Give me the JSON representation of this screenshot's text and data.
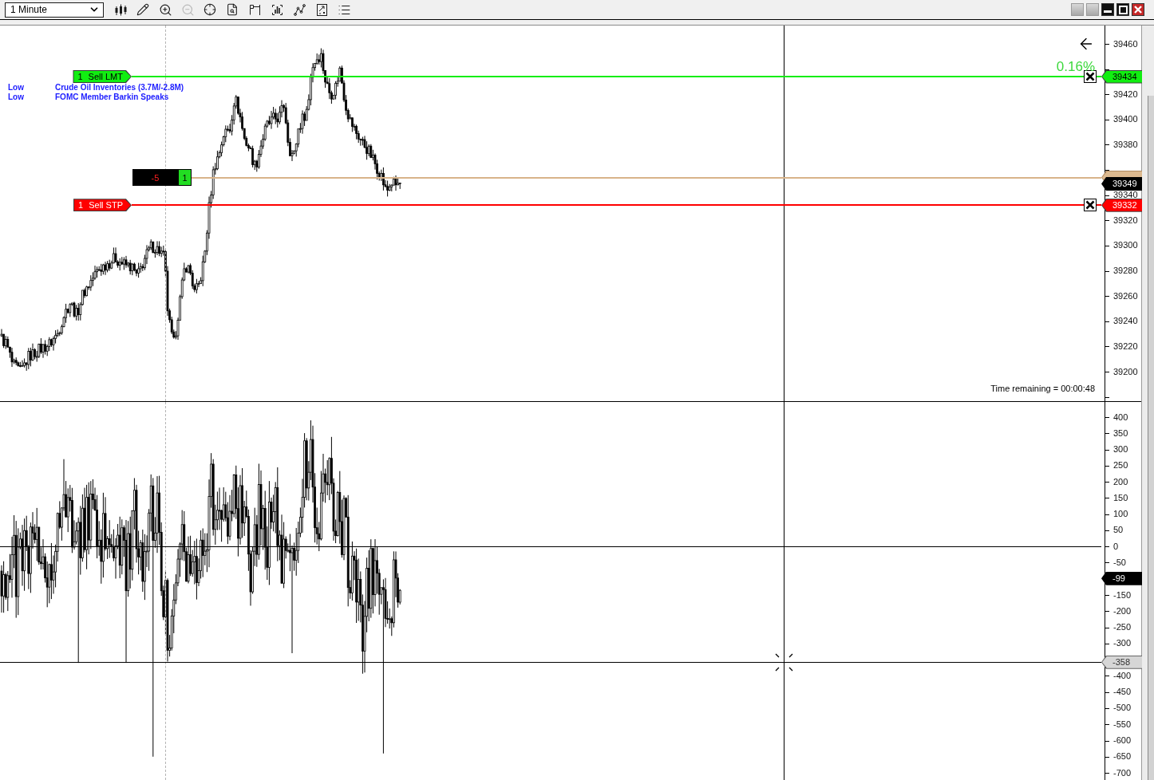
{
  "toolbar": {
    "interval": "1 Minute",
    "tools": [
      {
        "disabled": false
      },
      {
        "disabled": false
      },
      {
        "disabled": false
      },
      {
        "disabled": true
      },
      {
        "disabled": false
      },
      {
        "disabled": false
      },
      {
        "disabled": false
      },
      {
        "disabled": false
      },
      {
        "disabled": false
      },
      {
        "disabled": false
      },
      {
        "disabled": false
      }
    ]
  },
  "price_panel": {
    "events": [
      {
        "impact": "Low",
        "title": "Crude Oil Inventories (3.7M/-2.8M)"
      },
      {
        "impact": "Low",
        "title": "FOMC Member Barkin Speaks"
      }
    ],
    "orders": [
      {
        "quantity": "1",
        "label": "Sell LMT",
        "price": "39434",
        "color": "#11ee11"
      },
      {
        "quantity": "1",
        "label": "Sell STP",
        "price": "39332",
        "color": "#ff0000"
      }
    ],
    "position": {
      "pnl": "-5",
      "quantity": "1"
    },
    "percent_change": "0.16%",
    "last_price": "39349",
    "time_remaining": "Time remaining = 00:00:48",
    "axis_labels": [
      "39460",
      "39420",
      "39400",
      "39380",
      "39340",
      "39320",
      "39300",
      "39280",
      "39260",
      "39240",
      "39220",
      "39200"
    ]
  },
  "indicator_panel": {
    "axis_labels": [
      "400",
      "350",
      "300",
      "250",
      "200",
      "150",
      "100",
      "50",
      "0",
      "-50",
      "-150",
      "-200",
      "-250",
      "-300",
      "-400",
      "-450",
      "-500",
      "-550",
      "-600",
      "-650",
      "-700"
    ],
    "last_value": "-99",
    "crosshair_value": "-358"
  }
}
